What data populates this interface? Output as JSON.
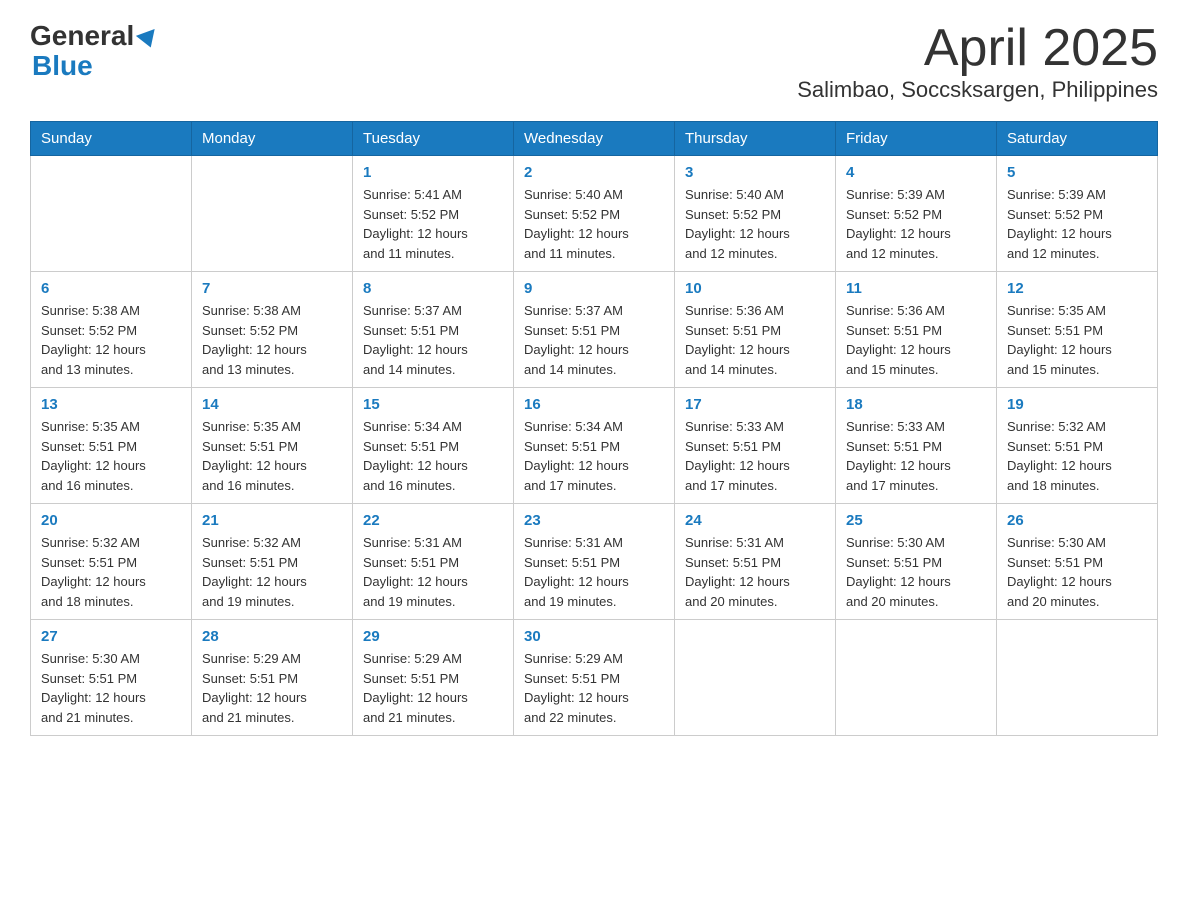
{
  "header": {
    "logo_general": "General",
    "logo_blue": "Blue",
    "title": "April 2025",
    "location": "Salimbao, Soccsksargen, Philippines"
  },
  "days_of_week": [
    "Sunday",
    "Monday",
    "Tuesday",
    "Wednesday",
    "Thursday",
    "Friday",
    "Saturday"
  ],
  "weeks": [
    [
      {
        "day": "",
        "info": ""
      },
      {
        "day": "",
        "info": ""
      },
      {
        "day": "1",
        "info": "Sunrise: 5:41 AM\nSunset: 5:52 PM\nDaylight: 12 hours\nand 11 minutes."
      },
      {
        "day": "2",
        "info": "Sunrise: 5:40 AM\nSunset: 5:52 PM\nDaylight: 12 hours\nand 11 minutes."
      },
      {
        "day": "3",
        "info": "Sunrise: 5:40 AM\nSunset: 5:52 PM\nDaylight: 12 hours\nand 12 minutes."
      },
      {
        "day": "4",
        "info": "Sunrise: 5:39 AM\nSunset: 5:52 PM\nDaylight: 12 hours\nand 12 minutes."
      },
      {
        "day": "5",
        "info": "Sunrise: 5:39 AM\nSunset: 5:52 PM\nDaylight: 12 hours\nand 12 minutes."
      }
    ],
    [
      {
        "day": "6",
        "info": "Sunrise: 5:38 AM\nSunset: 5:52 PM\nDaylight: 12 hours\nand 13 minutes."
      },
      {
        "day": "7",
        "info": "Sunrise: 5:38 AM\nSunset: 5:52 PM\nDaylight: 12 hours\nand 13 minutes."
      },
      {
        "day": "8",
        "info": "Sunrise: 5:37 AM\nSunset: 5:51 PM\nDaylight: 12 hours\nand 14 minutes."
      },
      {
        "day": "9",
        "info": "Sunrise: 5:37 AM\nSunset: 5:51 PM\nDaylight: 12 hours\nand 14 minutes."
      },
      {
        "day": "10",
        "info": "Sunrise: 5:36 AM\nSunset: 5:51 PM\nDaylight: 12 hours\nand 14 minutes."
      },
      {
        "day": "11",
        "info": "Sunrise: 5:36 AM\nSunset: 5:51 PM\nDaylight: 12 hours\nand 15 minutes."
      },
      {
        "day": "12",
        "info": "Sunrise: 5:35 AM\nSunset: 5:51 PM\nDaylight: 12 hours\nand 15 minutes."
      }
    ],
    [
      {
        "day": "13",
        "info": "Sunrise: 5:35 AM\nSunset: 5:51 PM\nDaylight: 12 hours\nand 16 minutes."
      },
      {
        "day": "14",
        "info": "Sunrise: 5:35 AM\nSunset: 5:51 PM\nDaylight: 12 hours\nand 16 minutes."
      },
      {
        "day": "15",
        "info": "Sunrise: 5:34 AM\nSunset: 5:51 PM\nDaylight: 12 hours\nand 16 minutes."
      },
      {
        "day": "16",
        "info": "Sunrise: 5:34 AM\nSunset: 5:51 PM\nDaylight: 12 hours\nand 17 minutes."
      },
      {
        "day": "17",
        "info": "Sunrise: 5:33 AM\nSunset: 5:51 PM\nDaylight: 12 hours\nand 17 minutes."
      },
      {
        "day": "18",
        "info": "Sunrise: 5:33 AM\nSunset: 5:51 PM\nDaylight: 12 hours\nand 17 minutes."
      },
      {
        "day": "19",
        "info": "Sunrise: 5:32 AM\nSunset: 5:51 PM\nDaylight: 12 hours\nand 18 minutes."
      }
    ],
    [
      {
        "day": "20",
        "info": "Sunrise: 5:32 AM\nSunset: 5:51 PM\nDaylight: 12 hours\nand 18 minutes."
      },
      {
        "day": "21",
        "info": "Sunrise: 5:32 AM\nSunset: 5:51 PM\nDaylight: 12 hours\nand 19 minutes."
      },
      {
        "day": "22",
        "info": "Sunrise: 5:31 AM\nSunset: 5:51 PM\nDaylight: 12 hours\nand 19 minutes."
      },
      {
        "day": "23",
        "info": "Sunrise: 5:31 AM\nSunset: 5:51 PM\nDaylight: 12 hours\nand 19 minutes."
      },
      {
        "day": "24",
        "info": "Sunrise: 5:31 AM\nSunset: 5:51 PM\nDaylight: 12 hours\nand 20 minutes."
      },
      {
        "day": "25",
        "info": "Sunrise: 5:30 AM\nSunset: 5:51 PM\nDaylight: 12 hours\nand 20 minutes."
      },
      {
        "day": "26",
        "info": "Sunrise: 5:30 AM\nSunset: 5:51 PM\nDaylight: 12 hours\nand 20 minutes."
      }
    ],
    [
      {
        "day": "27",
        "info": "Sunrise: 5:30 AM\nSunset: 5:51 PM\nDaylight: 12 hours\nand 21 minutes."
      },
      {
        "day": "28",
        "info": "Sunrise: 5:29 AM\nSunset: 5:51 PM\nDaylight: 12 hours\nand 21 minutes."
      },
      {
        "day": "29",
        "info": "Sunrise: 5:29 AM\nSunset: 5:51 PM\nDaylight: 12 hours\nand 21 minutes."
      },
      {
        "day": "30",
        "info": "Sunrise: 5:29 AM\nSunset: 5:51 PM\nDaylight: 12 hours\nand 22 minutes."
      },
      {
        "day": "",
        "info": ""
      },
      {
        "day": "",
        "info": ""
      },
      {
        "day": "",
        "info": ""
      }
    ]
  ]
}
